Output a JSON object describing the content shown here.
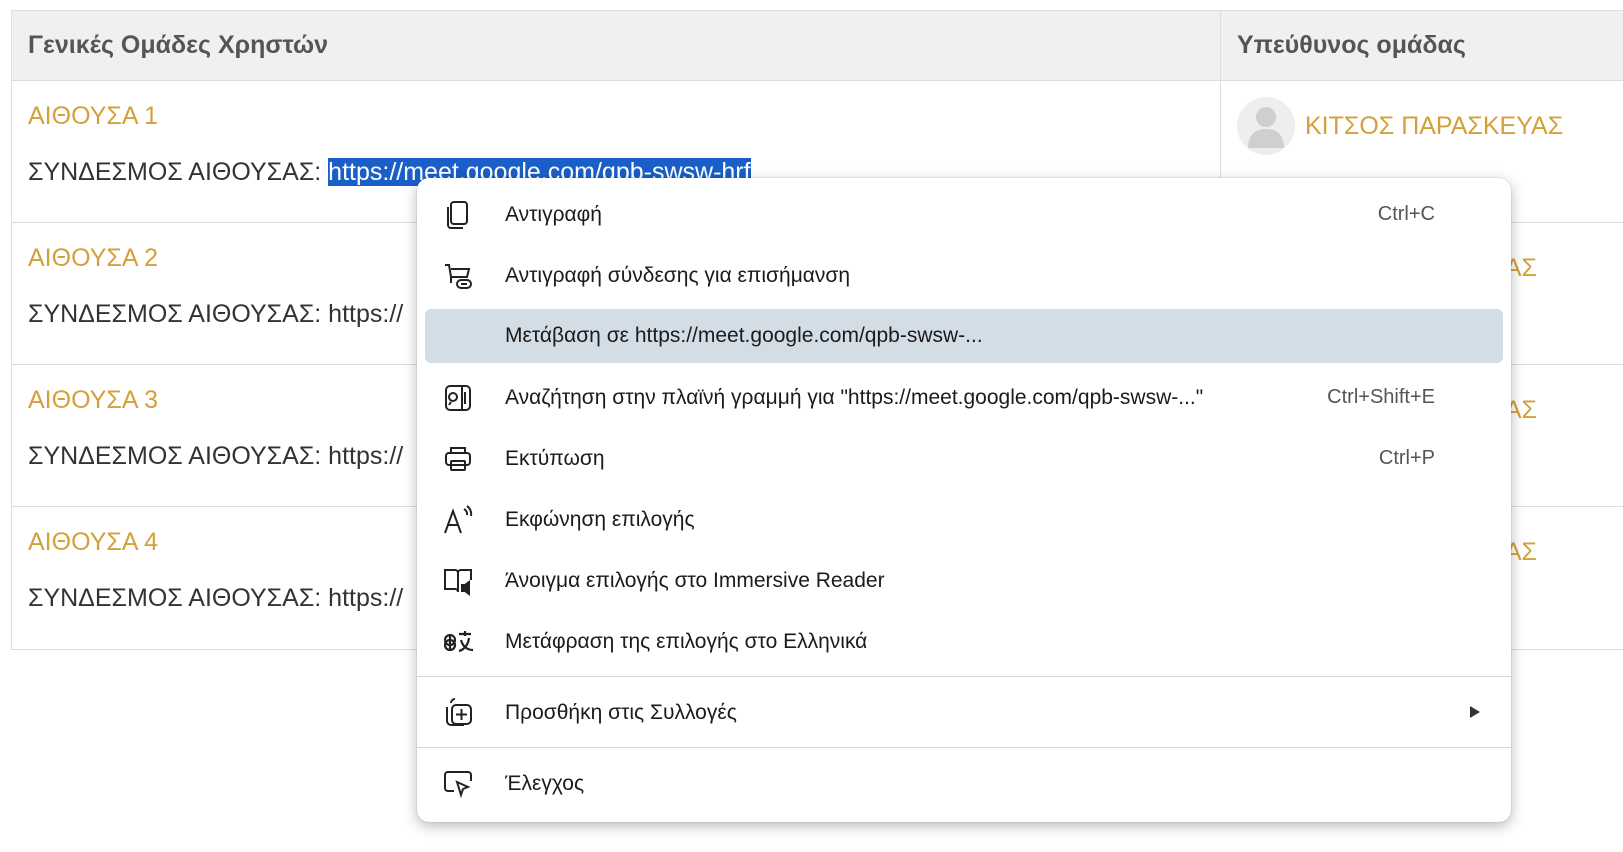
{
  "table": {
    "headers": [
      "Γενικές Ομάδες Χρηστών",
      "Υπεύθυνος ομάδας"
    ],
    "rows": [
      {
        "room": "ΑΙΘΟΥΣΑ 1",
        "link_label": "ΣΥΝΔΕΣΜΟΣ ΑΙΘΟΥΣΑΣ: ",
        "link_text": "https://meet.google.com/qpb-swsw-hrf",
        "responsible": "ΚΙΤΣΟΣ ΠΑΡΑΣΚΕΥΑΣ"
      },
      {
        "room": "ΑΙΘΟΥΣΑ 2",
        "link_label": "ΣΥΝΔΕΣΜΟΣ ΑΙΘΟΥΣΑΣ: ",
        "link_text": "https://",
        "responsible": "ΥΑΣ"
      },
      {
        "room": "ΑΙΘΟΥΣΑ 3",
        "link_label": "ΣΥΝΔΕΣΜΟΣ ΑΙΘΟΥΣΑΣ: ",
        "link_text": "https://",
        "responsible": "ΥΑΣ"
      },
      {
        "room": "ΑΙΘΟΥΣΑ 4",
        "link_label": "ΣΥΝΔΕΣΜΟΣ ΑΙΘΟΥΣΑΣ: ",
        "link_text": "https://",
        "responsible": "ΥΑΣ"
      }
    ]
  },
  "context_menu": {
    "items": [
      {
        "icon": "copy-icon",
        "label": "Αντιγραφή",
        "shortcut": "Ctrl+C"
      },
      {
        "icon": "copy-link-highlight-icon",
        "label": "Αντιγραφή σύνδεσης για επισήμανση",
        "shortcut": ""
      },
      {
        "icon": "",
        "label": "Μετάβαση σε https://meet.google.com/qpb-swsw-...",
        "shortcut": "",
        "highlighted": true
      },
      {
        "icon": "search-sidebar-icon",
        "label": "Αναζήτηση στην πλαϊνή γραμμή για \"https://meet.google.com/qpb-swsw-...\"",
        "shortcut": "Ctrl+Shift+E"
      },
      {
        "icon": "print-icon",
        "label": "Εκτύπωση",
        "shortcut": "Ctrl+P"
      },
      {
        "icon": "read-aloud-icon",
        "label": "Εκφώνηση επιλογής",
        "shortcut": ""
      },
      {
        "icon": "immersive-reader-icon",
        "label": "Άνοιγμα επιλογής στο Immersive Reader",
        "shortcut": ""
      },
      {
        "icon": "translate-icon",
        "label": "Μετάφραση της επιλογής στο Ελληνικά",
        "shortcut": ""
      },
      {
        "icon": "add-collection-icon",
        "label": "Προσθήκη στις Συλλογές",
        "shortcut": "",
        "submenu": true
      },
      {
        "icon": "inspect-icon",
        "label": "Έλεγχος",
        "shortcut": ""
      }
    ]
  },
  "colors": {
    "accent": "#d4a03a",
    "selection": "#1a5fc8",
    "menu_highlight": "#d3dde6"
  }
}
